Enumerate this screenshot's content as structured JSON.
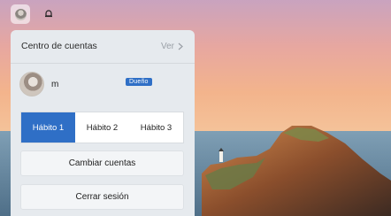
{
  "account_center": {
    "title": "Centro de cuentas",
    "view_link": "Ver"
  },
  "user": {
    "name": "m",
    "badge": "Dueño"
  },
  "tabs": [
    {
      "label": "Hábito 1",
      "active": true
    },
    {
      "label": "Hábito 2",
      "active": false
    },
    {
      "label": "Hábito 3",
      "active": false
    }
  ],
  "actions": {
    "switch_accounts": "Cambiar cuentas",
    "sign_out": "Cerrar sesión"
  },
  "icons": {
    "avatar_button": "avatar-icon",
    "notifications": "bell-icon",
    "view_chevron": "chevron-right-icon"
  },
  "colors": {
    "accent": "#2f6fc6",
    "panel_bg": "#e6eaee"
  }
}
